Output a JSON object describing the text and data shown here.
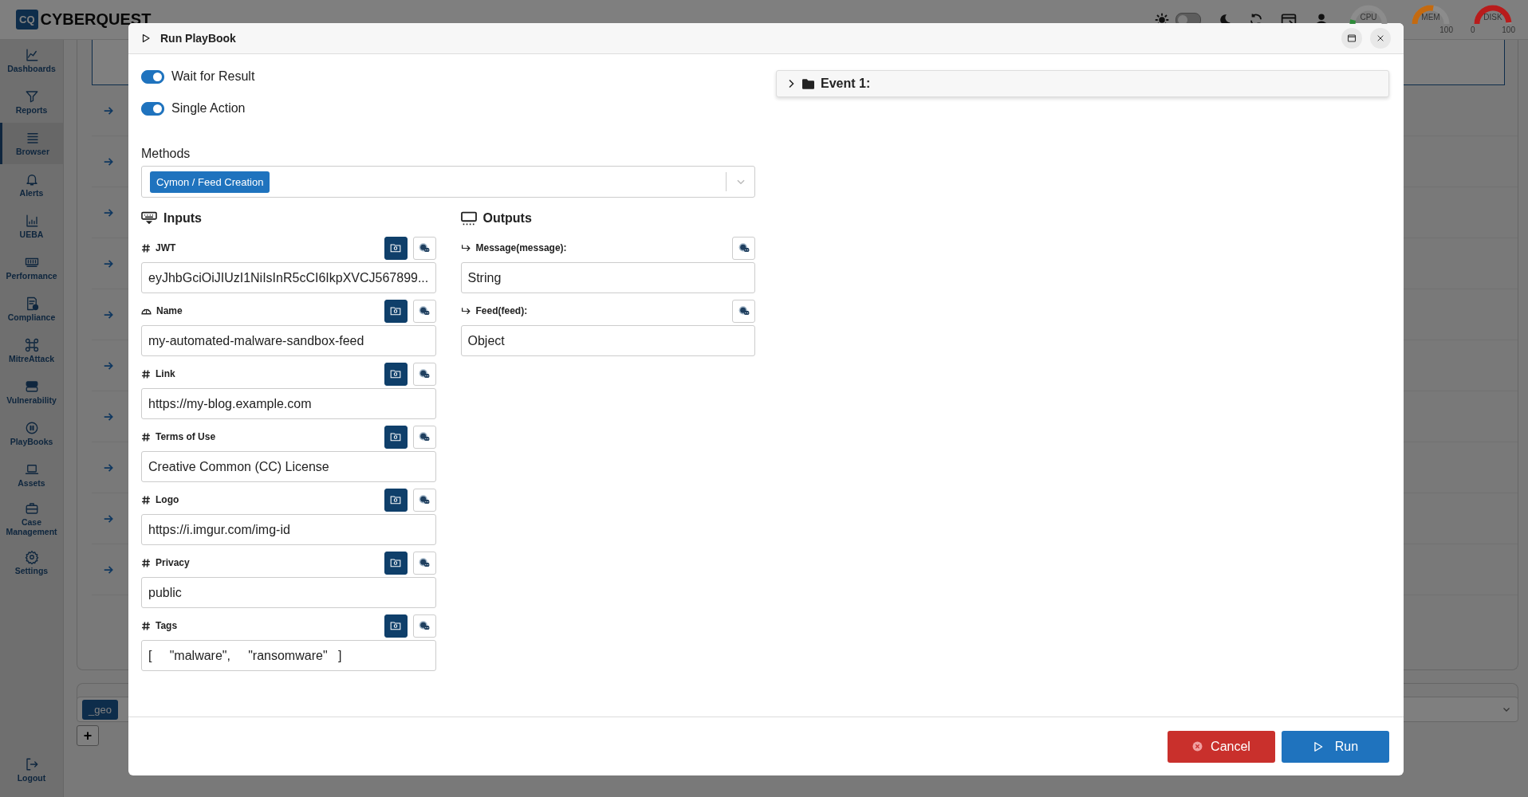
{
  "top_bar": {
    "logo_badge": "CQ",
    "logo_text": "CYBERQUEST",
    "theme_switch": {
      "on": false
    },
    "gauges": [
      {
        "label": "CPU",
        "level": 0.08,
        "color": "#2e8b3a"
      },
      {
        "label": "MEM",
        "level": 0.55,
        "color": "#c46a10",
        "max": "100"
      },
      {
        "label": "DISK",
        "level": 0.97,
        "color": "#b81c1c",
        "min": "0",
        "max": "100"
      }
    ]
  },
  "sidebar": {
    "items": [
      {
        "label": "Dashboards",
        "selected": false
      },
      {
        "label": "Reports",
        "selected": false
      },
      {
        "label": "Browser",
        "selected": true
      },
      {
        "label": "Alerts",
        "selected": false
      },
      {
        "label": "UEBA",
        "selected": false
      },
      {
        "label": "Performance",
        "selected": false
      },
      {
        "label": "Compliance",
        "selected": false
      },
      {
        "label": "MitreAttack",
        "selected": false
      },
      {
        "label": "Vulnerability",
        "selected": false
      },
      {
        "label": "PlayBooks",
        "selected": false
      },
      {
        "label": "Assets",
        "selected": false
      },
      {
        "label": "Case Management",
        "selected": false
      },
      {
        "label": "Settings",
        "selected": false
      }
    ],
    "logout": "Logout"
  },
  "background": {
    "tag": "_geo",
    "add_button": "+"
  },
  "dialog": {
    "title": "Run PlayBook",
    "toggles": [
      {
        "label": "Wait for Result",
        "on": true
      },
      {
        "label": "Single Action",
        "on": true
      }
    ],
    "methods": {
      "label": "Methods",
      "selected": [
        "Cymon / Feed Creation"
      ]
    },
    "inputs": {
      "title": "Inputs",
      "fields": [
        {
          "label": "JWT",
          "kind": "number",
          "value": "eyJhbGciOiJIUzI1NiIsInR5cCI6IkpXVCJ567899..."
        },
        {
          "label": "Name",
          "kind": "text",
          "value": "my-automated-malware-sandbox-feed"
        },
        {
          "label": "Link",
          "kind": "number",
          "value": "https://my-blog.example.com"
        },
        {
          "label": "Terms of Use",
          "kind": "number",
          "value": "Creative Common (CC) License"
        },
        {
          "label": "Logo",
          "kind": "number",
          "value": "https://i.imgur.com/img-id"
        },
        {
          "label": "Privacy",
          "kind": "number",
          "value": "public"
        },
        {
          "label": "Tags",
          "kind": "number",
          "value": "[     \"malware\",     \"ransomware\"   ]"
        }
      ]
    },
    "outputs": {
      "title": "Outputs",
      "fields": [
        {
          "label": "Message(message):",
          "value": "String"
        },
        {
          "label": "Feed(feed):",
          "value": "Object"
        }
      ]
    },
    "events": [
      {
        "label": "Event 1:",
        "expanded": false
      }
    ],
    "buttons": [
      {
        "label": "Cancel",
        "kind": "cancel"
      },
      {
        "label": "Run",
        "kind": "run"
      }
    ]
  }
}
